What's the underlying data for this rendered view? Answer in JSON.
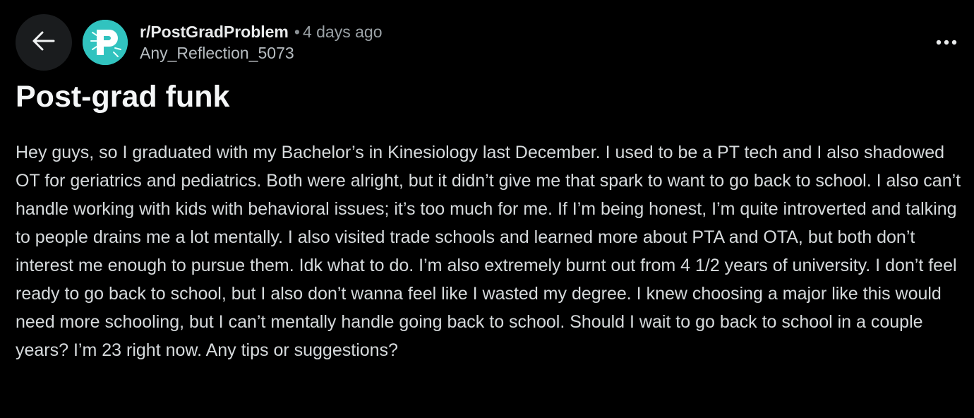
{
  "colors": {
    "background": "#000000",
    "button_bg": "#1a1c1e",
    "avatar_bg": "#31c3bf",
    "title_text": "#f4f6f7",
    "body_text": "#d6dadc",
    "meta_text": "#9ba2a6"
  },
  "nav": {
    "back_icon": "arrow-left-icon",
    "more_icon": "more-horizontal-icon"
  },
  "post": {
    "subreddit": "r/PostGradProblem",
    "separator": "•",
    "timestamp": "4 days ago",
    "author": "Any_Reflection_5073",
    "avatar_icon": "subreddit-logo-p-icon",
    "title": "Post-grad funk",
    "body": "Hey guys, so I graduated with my Bachelor’s in Kinesiology last December. I used to be a PT tech and I also shadowed OT for geriatrics and pediatrics. Both were alright, but it didn’t give me that spark to want to go back to school. I also can’t handle working with kids with behavioral issues; it’s too much for me. If I’m being honest, I’m quite introverted and talking to people drains me a lot mentally. I also visited trade schools and learned more about PTA and OTA, but both don’t interest me enough to pursue them. Idk what to do. I’m also extremely burnt out from 4 1/2 years of university. I don’t feel ready to go back to school, but I also don’t wanna feel like I wasted my degree. I knew choosing a major like this would need more schooling, but I can’t mentally handle going back to school. Should I wait to go back to school in a couple years? I’m 23 right now. Any tips or suggestions?"
  }
}
